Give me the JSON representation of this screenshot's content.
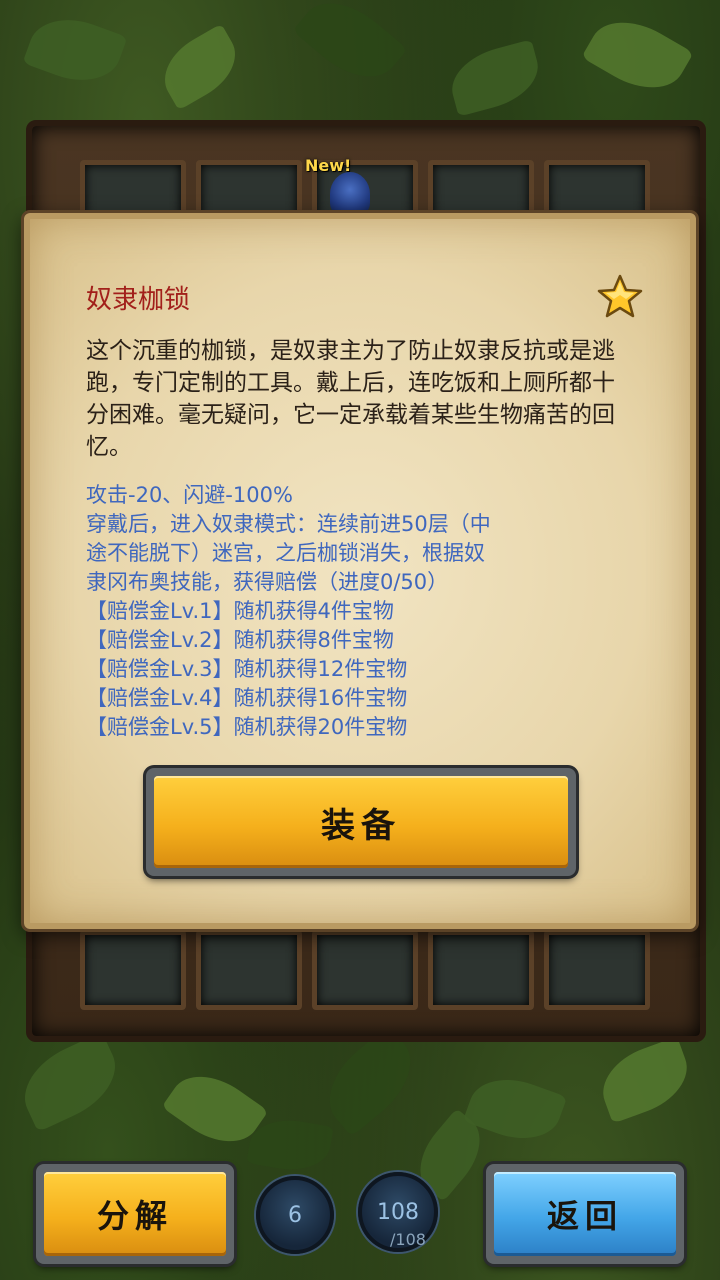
{
  "inventory": {
    "new_badge": "New!"
  },
  "dialog": {
    "title": "奴隶枷锁",
    "favorite_icon": "star-icon",
    "description": "这个沉重的枷锁，是奴隶主为了防止奴隶反抗或是逃跑，专门定制的工具。戴上后，连吃饭和上厕所都十分困难。毫无疑问，它一定承载着某些生物痛苦的回忆。",
    "stats_lines": [
      "攻击-20、闪避-100%",
      "穿戴后，进入奴隶模式：连续前进50层（中",
      "途不能脱下）迷宫，之后枷锁消失，根据奴",
      "隶冈布奥技能，获得赔偿（进度0/50）",
      "【赔偿金Lv.1】随机获得4件宝物",
      "【赔偿金Lv.2】随机获得8件宝物",
      "【赔偿金Lv.3】随机获得12件宝物",
      "【赔偿金Lv.4】随机获得16件宝物",
      "【赔偿金Lv.5】随机获得20件宝物"
    ],
    "equip_label": "装备"
  },
  "bottom_bar": {
    "decompose_label": "分解",
    "counter_left": "6",
    "counter_right": "108",
    "counter_right_max": "/108",
    "back_label": "返回"
  },
  "colors": {
    "title": "#a2201b",
    "stats_text": "#3f67be",
    "gold_button": "#f5b01c",
    "blue_button": "#43a6e8"
  }
}
